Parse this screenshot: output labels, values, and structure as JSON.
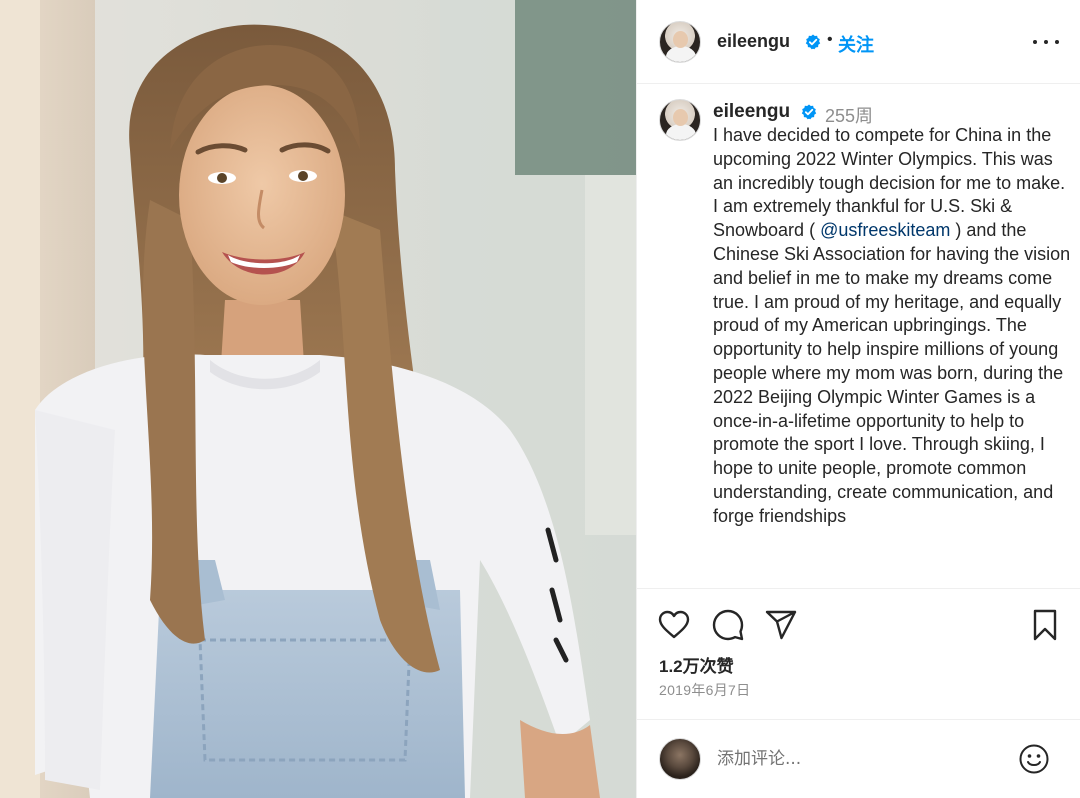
{
  "post": {
    "username": "eileengu",
    "follow_label": "关注",
    "separator": "•",
    "time_ago": "255周",
    "caption_before_mention": "I have decided to compete for China in the upcoming 2022 Winter Olympics. This was an incredibly tough decision for me to make. I am extremely thankful for U.S. Ski & Snowboard ( ",
    "mention": "@usfreeskiteam",
    "caption_after_mention": " ) and the Chinese Ski Association for having the vision and belief in me to make my dreams come true. I am proud of my heritage, and equally proud of my American upbringings. The opportunity to help inspire millions of young people where my mom was born, during the 2022 Beijing Olympic Winter Games is a once-in-a-lifetime opportunity to help to promote the sport I love. Through skiing, I hope to unite people, promote common understanding, create communication, and forge friendships",
    "likes": "1.2万次赞",
    "date": "2019年6月7日",
    "comment_placeholder": "添加评论..."
  },
  "icons": {
    "verified": "verified-badge-icon",
    "more": "more-options-icon",
    "like": "heart-icon",
    "comment": "comment-bubble-icon",
    "share": "paper-plane-icon",
    "save": "bookmark-icon",
    "emoji": "emoji-icon"
  },
  "colors": {
    "accent": "#0095f6",
    "mention": "#00376b",
    "muted": "#8e8e8e",
    "text": "#262626"
  }
}
